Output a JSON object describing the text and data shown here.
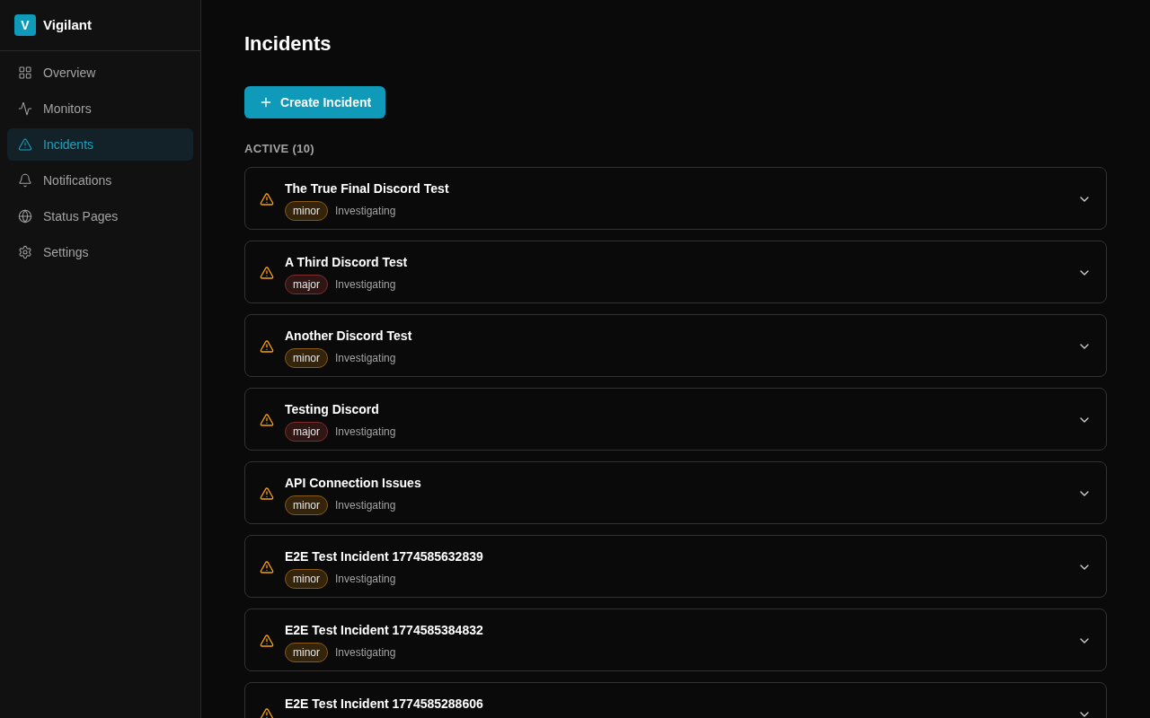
{
  "brand": {
    "logo_letter": "V",
    "name": "Vigilant"
  },
  "sidebar": {
    "items": [
      {
        "label": "Overview",
        "selected": false
      },
      {
        "label": "Monitors",
        "selected": false
      },
      {
        "label": "Incidents",
        "selected": true
      },
      {
        "label": "Notifications",
        "selected": false
      },
      {
        "label": "Status Pages",
        "selected": false
      },
      {
        "label": "Settings",
        "selected": false
      }
    ]
  },
  "page": {
    "title": "Incidents",
    "create_button": "Create Incident",
    "section_heading": "ACTIVE (10)"
  },
  "incidents": [
    {
      "title": "The True Final Discord Test",
      "severity": {
        "label": "minor",
        "color": "#8a5a12"
      },
      "status": "Investigating"
    },
    {
      "title": "A Third Discord Test",
      "severity": {
        "label": "major",
        "color": "#7f2d2d"
      },
      "status": "Investigating"
    },
    {
      "title": "Another Discord Test",
      "severity": {
        "label": "minor",
        "color": "#8a5a12"
      },
      "status": "Investigating"
    },
    {
      "title": "Testing Discord",
      "severity": {
        "label": "major",
        "color": "#7f2d2d"
      },
      "status": "Investigating"
    },
    {
      "title": "API Connection Issues",
      "severity": {
        "label": "minor",
        "color": "#8a5a12"
      },
      "status": "Investigating"
    },
    {
      "title": "E2E Test Incident 1774585632839",
      "severity": {
        "label": "minor",
        "color": "#8a5a12"
      },
      "status": "Investigating"
    },
    {
      "title": "E2E Test Incident 1774585384832",
      "severity": {
        "label": "minor",
        "color": "#8a5a12"
      },
      "status": "Investigating"
    },
    {
      "title": "E2E Test Incident 1774585288606"
    }
  ]
}
